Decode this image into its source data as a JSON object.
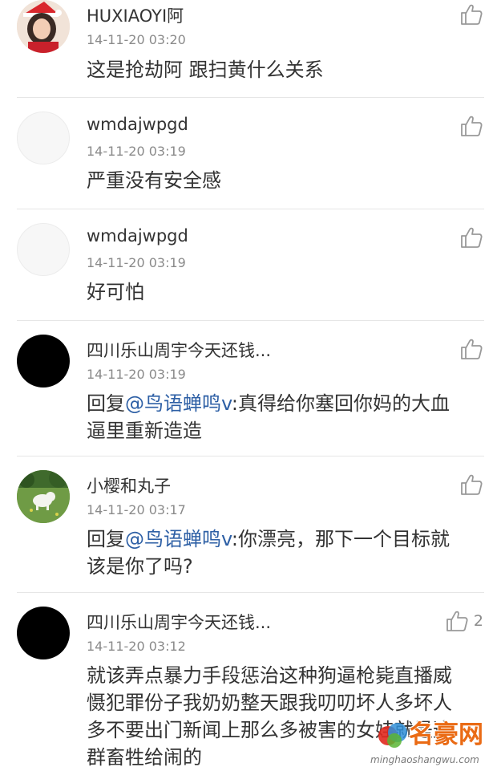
{
  "comments": [
    {
      "username": "HUXIAOYI阿",
      "time": "14-11-20 03:20",
      "text_lines": [
        "这是抢劫阿 跟扫黄什么关系"
      ],
      "avatar": "woman-photo-avatar",
      "like_icon": "thumbs-up-icon"
    },
    {
      "username": "wmdajwpgd",
      "time": "14-11-20 03:19",
      "text_lines": [
        "严重没有安全感"
      ],
      "avatar": "blank-avatar",
      "like_icon": "thumbs-up-icon"
    },
    {
      "username": "wmdajwpgd",
      "time": "14-11-20 03:19",
      "text_lines": [
        "好可怕"
      ],
      "avatar": "blank-avatar",
      "like_icon": "thumbs-up-icon"
    },
    {
      "username": "四川乐山周宇今天还钱...",
      "time": "14-11-20 03:19",
      "reply_prefix": "回复",
      "mention": "@鸟语蝉鸣v",
      "reply_text_first": ":真得给你塞回你妈的大血",
      "text_lines_rest": [
        "逼里重新造造"
      ],
      "avatar": "black-avatar",
      "like_icon": "thumbs-up-icon"
    },
    {
      "username": "小樱和丸子",
      "time": "14-11-20 03:17",
      "reply_prefix": "回复",
      "mention": "@鸟语蝉鸣v",
      "reply_text_first": ":你漂亮，那下一个目标就",
      "text_lines_rest": [
        "该是你了吗?"
      ],
      "avatar": "dog-photo-avatar",
      "like_icon": "thumbs-up-icon"
    },
    {
      "username": "四川乐山周宇今天还钱...",
      "time": "14-11-20 03:12",
      "text_lines": [
        "就该弄点暴力手段惩治这种狗逼枪毙直播威",
        "慑犯罪份子我奶奶整天跟我叨叨坏人多坏人",
        "多不要出门新闻上那么多被害的女娃就是这",
        "群畜牲给闹的"
      ],
      "avatar": "black-avatar",
      "like_icon": "thumbs-up-icon",
      "like_count": "2"
    }
  ],
  "watermark": {
    "name": "名豪网",
    "url": "minghaoshangwu.com"
  },
  "colors": {
    "mention": "#2d5fa5",
    "text": "#333333",
    "meta": "#8a8a8a",
    "divider": "#e6e6e6"
  }
}
